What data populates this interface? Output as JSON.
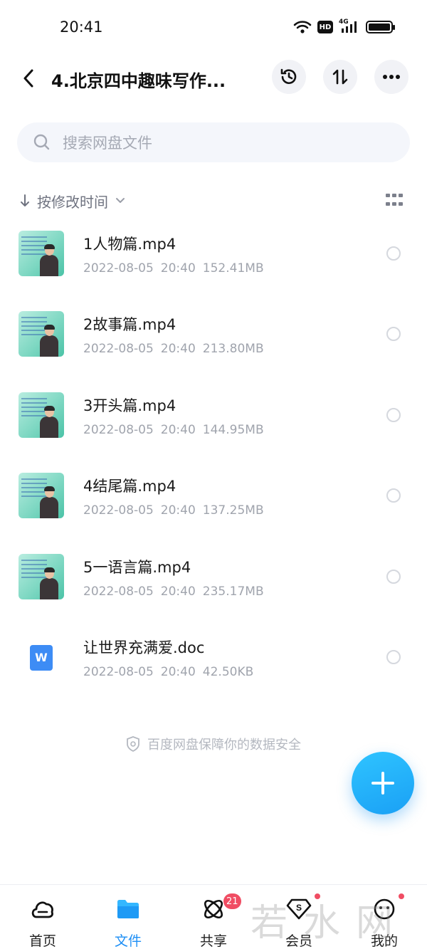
{
  "status_bar": {
    "time": "20:41",
    "hd_label": "HD",
    "network_label": "4G"
  },
  "header": {
    "title": "4.北京四中趣味写作..."
  },
  "search": {
    "placeholder": "搜索网盘文件"
  },
  "sort": {
    "label": "按修改时间"
  },
  "files": [
    {
      "name": "1人物篇.mp4",
      "date": "2022-08-05",
      "time": "20:40",
      "size": "152.41MB",
      "type": "video"
    },
    {
      "name": "2故事篇.mp4",
      "date": "2022-08-05",
      "time": "20:40",
      "size": "213.80MB",
      "type": "video"
    },
    {
      "name": "3开头篇.mp4",
      "date": "2022-08-05",
      "time": "20:40",
      "size": "144.95MB",
      "type": "video"
    },
    {
      "name": "4结尾篇.mp4",
      "date": "2022-08-05",
      "time": "20:40",
      "size": "137.25MB",
      "type": "video"
    },
    {
      "name": "5一语言篇.mp4",
      "date": "2022-08-05",
      "time": "20:40",
      "size": "235.17MB",
      "type": "video"
    },
    {
      "name": "让世界充满爱.doc",
      "date": "2022-08-05",
      "time": "20:40",
      "size": "42.50KB",
      "type": "doc",
      "icon_letter": "W"
    }
  ],
  "security_note": "百度网盘保障你的数据安全",
  "nav": [
    {
      "label": "首页",
      "icon": "cloud-icon",
      "active": false
    },
    {
      "label": "文件",
      "icon": "folder-icon",
      "active": true
    },
    {
      "label": "共享",
      "icon": "atom-icon",
      "active": false,
      "badge": "21"
    },
    {
      "label": "会员",
      "icon": "diamond-icon",
      "active": false
    },
    {
      "label": "我的",
      "icon": "profile-icon",
      "active": false
    }
  ],
  "watermark": "若水网",
  "colors": {
    "accent": "#1e8ff5",
    "badge": "#f04d63",
    "fab": "#1aa0f5",
    "doc_icon": "#3d8cf5"
  }
}
